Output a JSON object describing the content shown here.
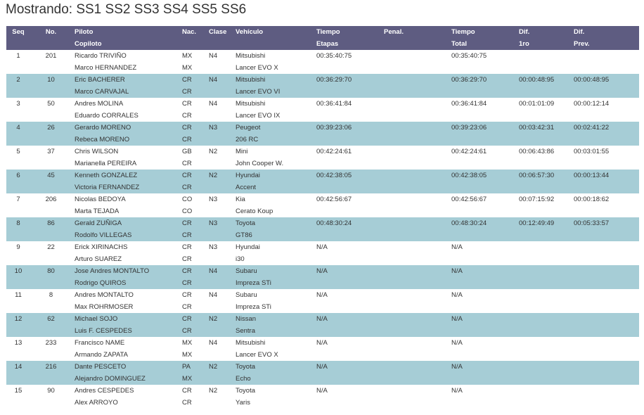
{
  "title": "Mostrando: SS1 SS2 SS3 SS4 SS5 SS6",
  "headers": {
    "seq": "Seq",
    "no": "No.",
    "piloto": "Piloto",
    "copiloto": "Copiloto",
    "nac": "Nac.",
    "clase": "Clase",
    "vehiculo": "Vehículo",
    "tiempo1": "Tiempo",
    "etapas": "Etapas",
    "penal": "Penal.",
    "tiempo2": "Tiempo",
    "total": "Total",
    "dif1": "Dif.",
    "primero": "1ro",
    "dif2": "Dif.",
    "prev": "Prev."
  },
  "rows": [
    {
      "seq": "1",
      "no": "201",
      "piloto": "Ricardo TRIVIÑO",
      "copiloto": "Marco HERNANDEZ",
      "nac1": "MX",
      "nac2": "MX",
      "clase": "N4",
      "marca": "Mitsubishi",
      "modelo": "Lancer EVO X",
      "etapas": "00:35:40:75",
      "penal": "",
      "total": "00:35:40:75",
      "dif1": "",
      "difp": ""
    },
    {
      "seq": "2",
      "no": "10",
      "piloto": "Eric BACHERER",
      "copiloto": "Marco CARVAJAL",
      "nac1": "CR",
      "nac2": "CR",
      "clase": "N4",
      "marca": "Mitsubishi",
      "modelo": "Lancer EVO VI",
      "etapas": "00:36:29:70",
      "penal": "",
      "total": "00:36:29:70",
      "dif1": "00:00:48:95",
      "difp": "00:00:48:95"
    },
    {
      "seq": "3",
      "no": "50",
      "piloto": "Andres MOLINA",
      "copiloto": "Eduardo CORRALES",
      "nac1": "CR",
      "nac2": "CR",
      "clase": "N4",
      "marca": "Mitsubishi",
      "modelo": "Lancer EVO IX",
      "etapas": "00:36:41:84",
      "penal": "",
      "total": "00:36:41:84",
      "dif1": "00:01:01:09",
      "difp": "00:00:12:14"
    },
    {
      "seq": "4",
      "no": "26",
      "piloto": "Gerardo MORENO",
      "copiloto": "Rebeca MORENO",
      "nac1": "CR",
      "nac2": "CR",
      "clase": "N3",
      "marca": "Peugeot",
      "modelo": "206 RC",
      "etapas": "00:39:23:06",
      "penal": "",
      "total": "00:39:23:06",
      "dif1": "00:03:42:31",
      "difp": "00:02:41:22"
    },
    {
      "seq": "5",
      "no": "37",
      "piloto": "Chris WILSON",
      "copiloto": "Marianella PEREIRA",
      "nac1": "GB",
      "nac2": "CR",
      "clase": "N2",
      "marca": "Mini",
      "modelo": "John Cooper W.",
      "etapas": "00:42:24:61",
      "penal": "",
      "total": "00:42:24:61",
      "dif1": "00:06:43:86",
      "difp": "00:03:01:55"
    },
    {
      "seq": "6",
      "no": "45",
      "piloto": "Kenneth GONZALEZ",
      "copiloto": "Victoria FERNANDEZ",
      "nac1": "CR",
      "nac2": "CR",
      "clase": "N2",
      "marca": "Hyundai",
      "modelo": "Accent",
      "etapas": "00:42:38:05",
      "penal": "",
      "total": "00:42:38:05",
      "dif1": "00:06:57:30",
      "difp": "00:00:13:44"
    },
    {
      "seq": "7",
      "no": "206",
      "piloto": "Nicolas BEDOYA",
      "copiloto": "Marta TEJADA",
      "nac1": "CO",
      "nac2": "CO",
      "clase": "N3",
      "marca": "Kia",
      "modelo": "Cerato Koup",
      "etapas": "00:42:56:67",
      "penal": "",
      "total": "00:42:56:67",
      "dif1": "00:07:15:92",
      "difp": "00:00:18:62"
    },
    {
      "seq": "8",
      "no": "86",
      "piloto": "Gerald ZUÑIGA",
      "copiloto": "Rodolfo VILLEGAS",
      "nac1": "CR",
      "nac2": "CR",
      "clase": "N3",
      "marca": "Toyota",
      "modelo": "GT86",
      "etapas": "00:48:30:24",
      "penal": "",
      "total": "00:48:30:24",
      "dif1": "00:12:49:49",
      "difp": "00:05:33:57"
    },
    {
      "seq": "9",
      "no": "22",
      "piloto": "Erick XIRINACHS",
      "copiloto": "Arturo SUAREZ",
      "nac1": "CR",
      "nac2": "CR",
      "clase": "N3",
      "marca": "Hyundai",
      "modelo": "i30",
      "etapas": "N/A",
      "penal": "",
      "total": "N/A",
      "dif1": "",
      "difp": ""
    },
    {
      "seq": "10",
      "no": "80",
      "piloto": "Jose Andres MONTALTO",
      "copiloto": "Rodrigo QUIROS",
      "nac1": "CR",
      "nac2": "CR",
      "clase": "N4",
      "marca": "Subaru",
      "modelo": "Impreza STi",
      "etapas": "N/A",
      "penal": "",
      "total": "N/A",
      "dif1": "",
      "difp": ""
    },
    {
      "seq": "11",
      "no": "8",
      "piloto": "Andres MONTALTO",
      "copiloto": "Max ROHRMOSER",
      "nac1": "CR",
      "nac2": "CR",
      "clase": "N4",
      "marca": "Subaru",
      "modelo": "Impreza STi",
      "etapas": "N/A",
      "penal": "",
      "total": "N/A",
      "dif1": "",
      "difp": ""
    },
    {
      "seq": "12",
      "no": "62",
      "piloto": "Michael SOJO",
      "copiloto": "Luis F. CESPEDES",
      "nac1": "CR",
      "nac2": "CR",
      "clase": "N2",
      "marca": "Nissan",
      "modelo": "Sentra",
      "etapas": "N/A",
      "penal": "",
      "total": "N/A",
      "dif1": "",
      "difp": ""
    },
    {
      "seq": "13",
      "no": "233",
      "piloto": "Francisco NAME",
      "copiloto": "Armando ZAPATA",
      "nac1": "MX",
      "nac2": "MX",
      "clase": "N4",
      "marca": "Mitsubishi",
      "modelo": "Lancer EVO X",
      "etapas": "N/A",
      "penal": "",
      "total": "N/A",
      "dif1": "",
      "difp": ""
    },
    {
      "seq": "14",
      "no": "216",
      "piloto": "Dante PESCETO",
      "copiloto": "Alejandro DOMINGUEZ",
      "nac1": "PA",
      "nac2": "MX",
      "clase": "N2",
      "marca": "Toyota",
      "modelo": "Echo",
      "etapas": "N/A",
      "penal": "",
      "total": "N/A",
      "dif1": "",
      "difp": ""
    },
    {
      "seq": "15",
      "no": "90",
      "piloto": "Andres CESPEDES",
      "copiloto": "Alex ARROYO",
      "nac1": "CR",
      "nac2": "CR",
      "clase": "N2",
      "marca": "Toyota",
      "modelo": "Yaris",
      "etapas": "N/A",
      "penal": "",
      "total": "N/A",
      "dif1": "",
      "difp": ""
    }
  ]
}
